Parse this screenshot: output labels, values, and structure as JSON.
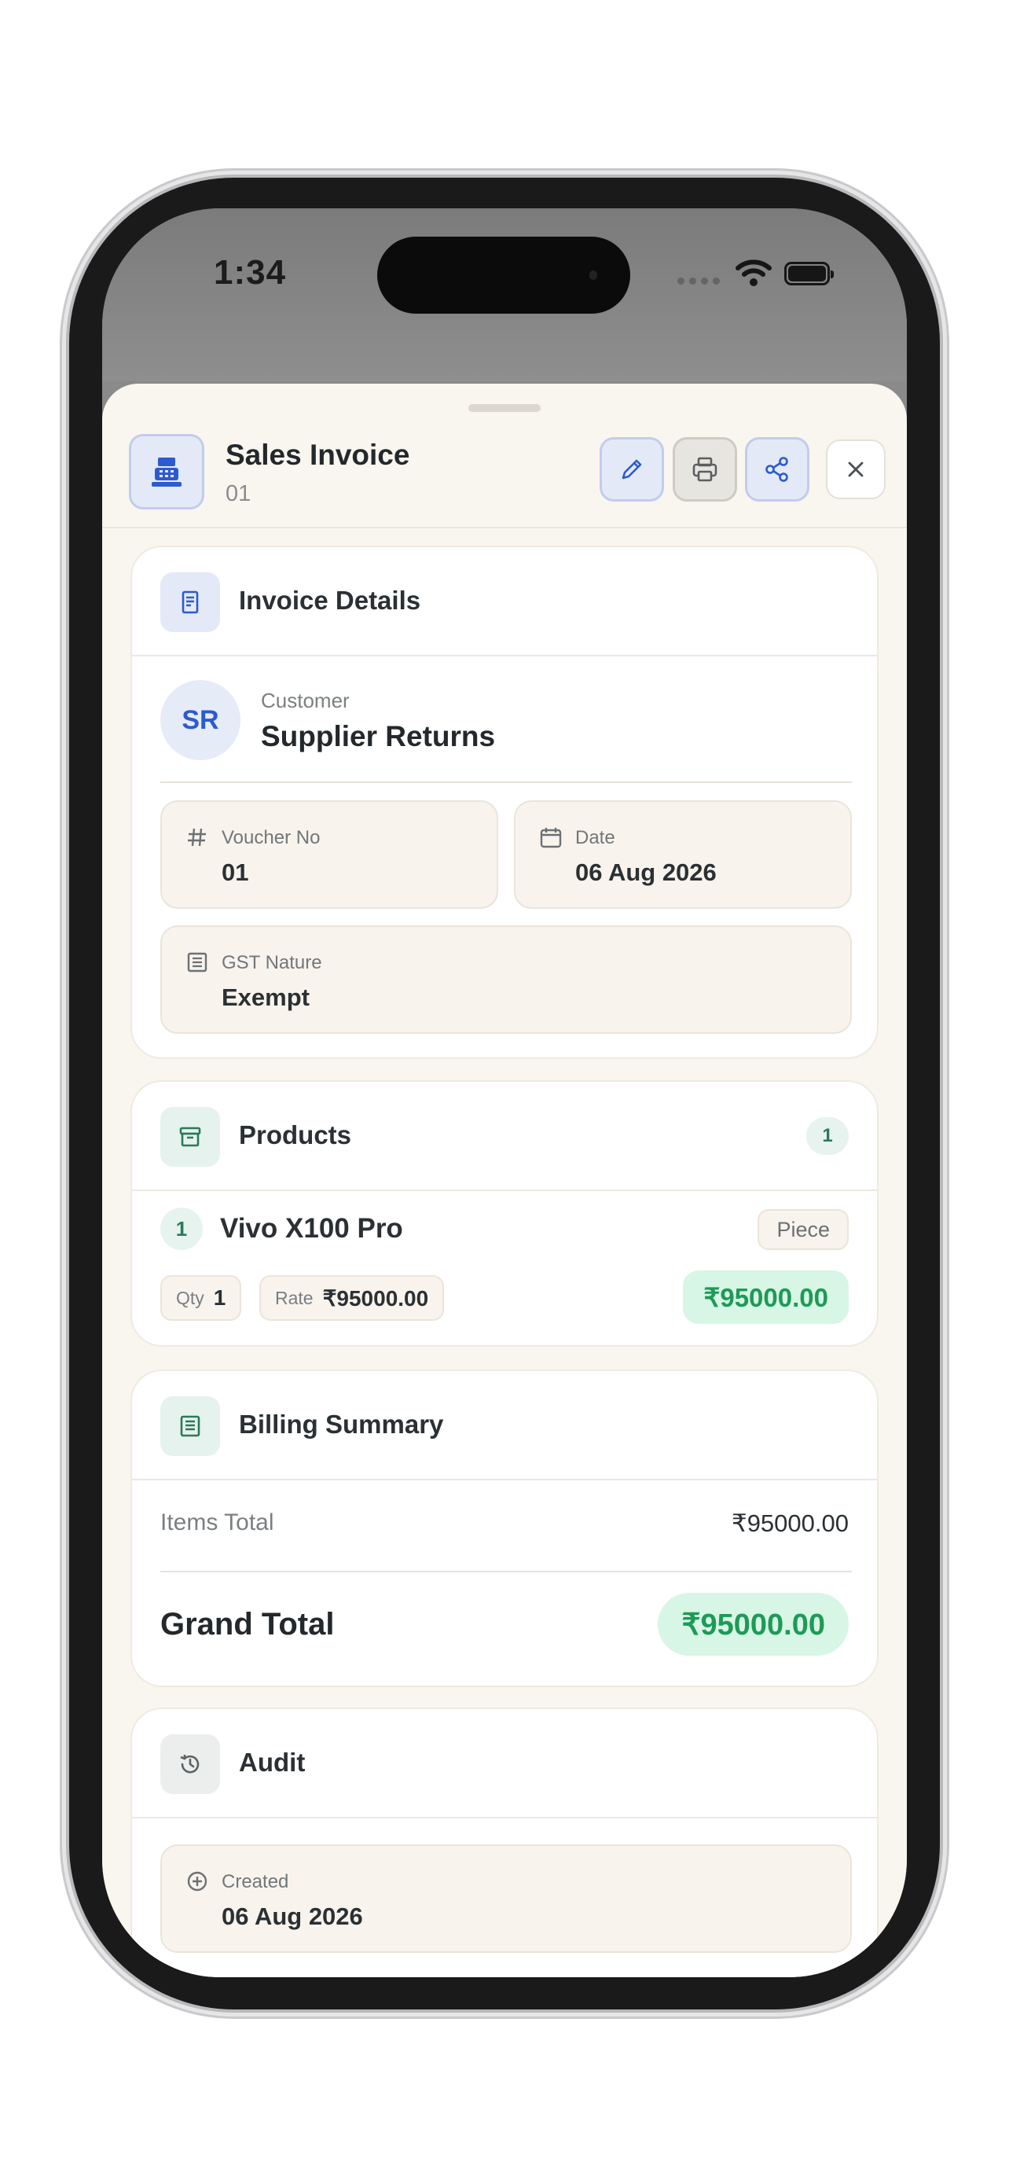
{
  "status_bar": {
    "time": "1:34"
  },
  "header": {
    "title": "Sales Invoice",
    "subtitle": "01",
    "icons": {
      "main": "cash-register-icon",
      "edit": "pencil-icon",
      "print": "printer-icon",
      "share": "share-icon",
      "close": "close-icon"
    }
  },
  "invoice_details": {
    "title": "Invoice Details",
    "avatar_initials": "SR",
    "customer_label": "Customer",
    "customer_name": "Supplier Returns",
    "voucher_label": "Voucher No",
    "voucher_value": "01",
    "date_label": "Date",
    "date_value": "06 Aug 2026",
    "gst_label": "GST Nature",
    "gst_value": "Exempt"
  },
  "products": {
    "title": "Products",
    "count": "1",
    "items": [
      {
        "index": "1",
        "name": "Vivo X100 Pro",
        "unit": "Piece",
        "qty_label": "Qty",
        "qty": "1",
        "rate_label": "Rate",
        "rate": "₹95000.00",
        "amount": "₹95000.00"
      }
    ]
  },
  "billing": {
    "title": "Billing Summary",
    "items_total_label": "Items Total",
    "items_total_value": "₹95000.00",
    "grand_total_label": "Grand Total",
    "grand_total_value": "₹95000.00"
  },
  "audit": {
    "title": "Audit",
    "created_label": "Created",
    "created_value": "06 Aug 2026"
  },
  "colors": {
    "sheet_bg": "#f9f6ef",
    "accent_blue": "#2c5bd0",
    "accent_green": "#1e9a57",
    "green_bg": "#d7f6e5"
  }
}
